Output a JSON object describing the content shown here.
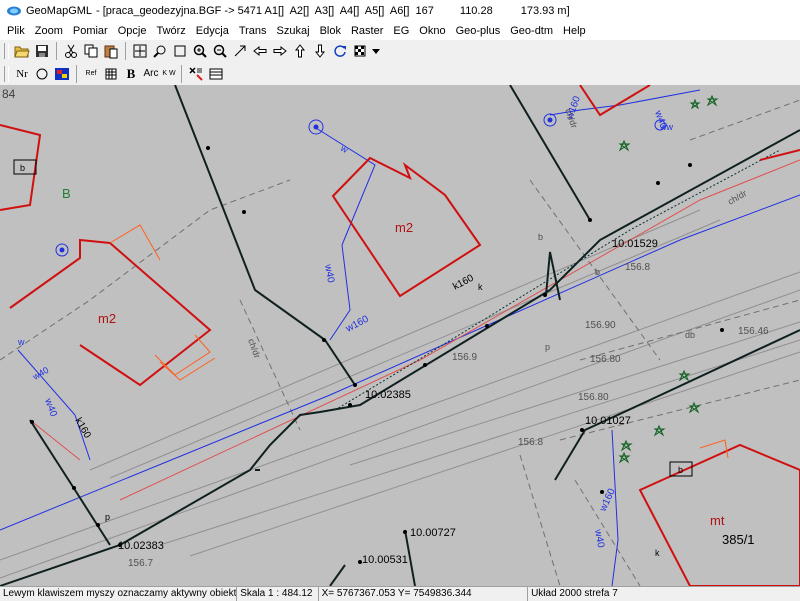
{
  "title": {
    "app_name": "GeoMapGML",
    "file": "- [praca_geodezyjna.BGF -> 5471 A1[]  A2[]  A3[]  A4[]  A5[]  A6[]  167",
    "value1": "110.28",
    "value2": "173.93 m]"
  },
  "menu": [
    "Plik",
    "Zoom",
    "Pomiar",
    "Opcje",
    "Twórz",
    "Edycja",
    "Trans",
    "Szukaj",
    "Blok",
    "Raster",
    "EG",
    "Okno",
    "Geo-plus",
    "Geo-dtm",
    "Help"
  ],
  "toolbar2": {
    "nr": "Nr",
    "ref": "Ref",
    "bold": "B",
    "arc": "Arc",
    "kw": "K W"
  },
  "map": {
    "labels": {
      "corner_num": "84",
      "b_label": "B",
      "m2_upper": "m2",
      "m2_left": "m2",
      "mt": "mt",
      "parcel": "385/1",
      "pt1": "10.01529",
      "pt2": "10.02385",
      "pt3": "10.01027",
      "pt4": "10.02383",
      "pt5": "10.00727",
      "pt6": "10.00531",
      "w40_a": "w40",
      "w40_b": "w40",
      "w40_c": "w40",
      "w40_d": "w40",
      "w160_a": "w160",
      "w160_b": "w160",
      "w160_c": "w160",
      "w_top": "w",
      "w_top2": "w",
      "w_right": "w40",
      "k160": "k160",
      "k160b": "k160",
      "ww": "ww",
      "chdr_a": "ch/dr",
      "chdr_b": "ch/dr",
      "chdr_c": "ch/dr",
      "v15690": "156.90",
      "v15680": "156.80",
      "v15680b": "156.80",
      "v15646": "156.46",
      "v1569": "156.9",
      "v1567": "156.7",
      "v1568": "156.8",
      "v15681": "156.8",
      "b_small": "b",
      "b_small2": "b",
      "b_small3": "b",
      "p_small": "p",
      "p_small2": "p",
      "k_small": "k",
      "k_small2": "k",
      "db": "db",
      "b_vert": "b"
    }
  },
  "status": {
    "hint": "Lewym klawiszem myszy oznaczamy aktywny obiekt",
    "scale": "Skala 1 : 484.12",
    "coords": "X=  5767367.053  Y=  7549836.344",
    "system": "Układ 2000 strefa 7"
  }
}
